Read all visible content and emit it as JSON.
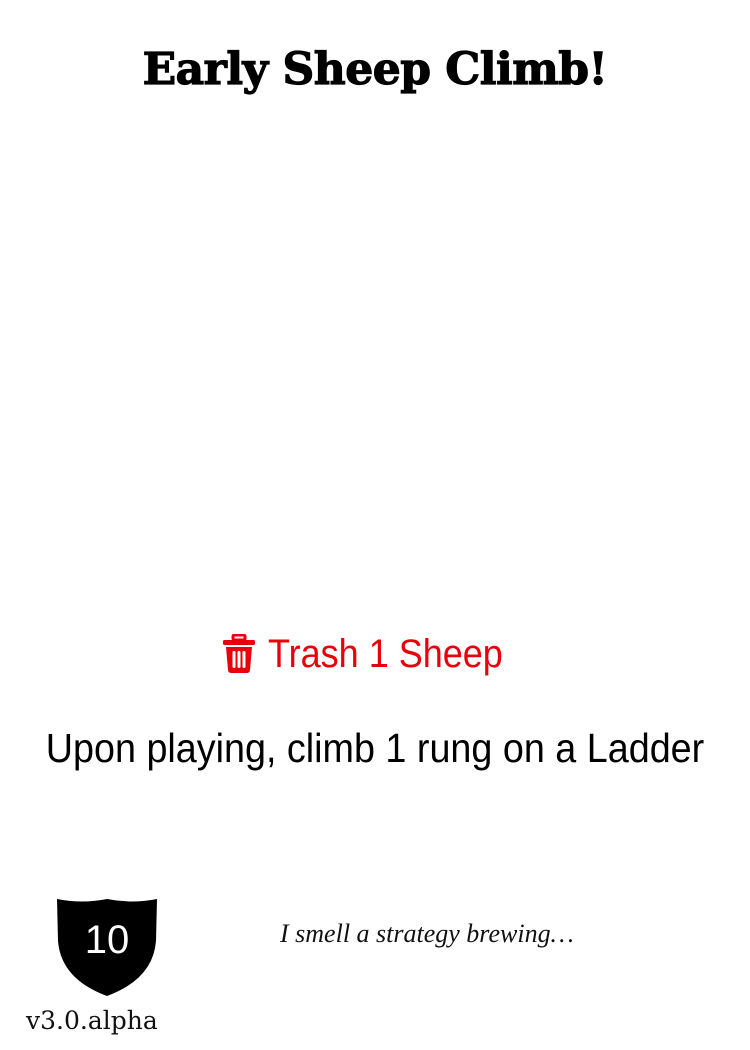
{
  "card": {
    "title": "Early Sheep Climb!",
    "cost": {
      "icon": "trash-icon",
      "text": "Trash 1 Sheep",
      "color": "#e8000b"
    },
    "effect": "Upon playing, climb 1 rung on a Ladder",
    "shield_value": "10",
    "version": "v3.0.alpha",
    "flavor": "I smell a strategy brewing…"
  }
}
